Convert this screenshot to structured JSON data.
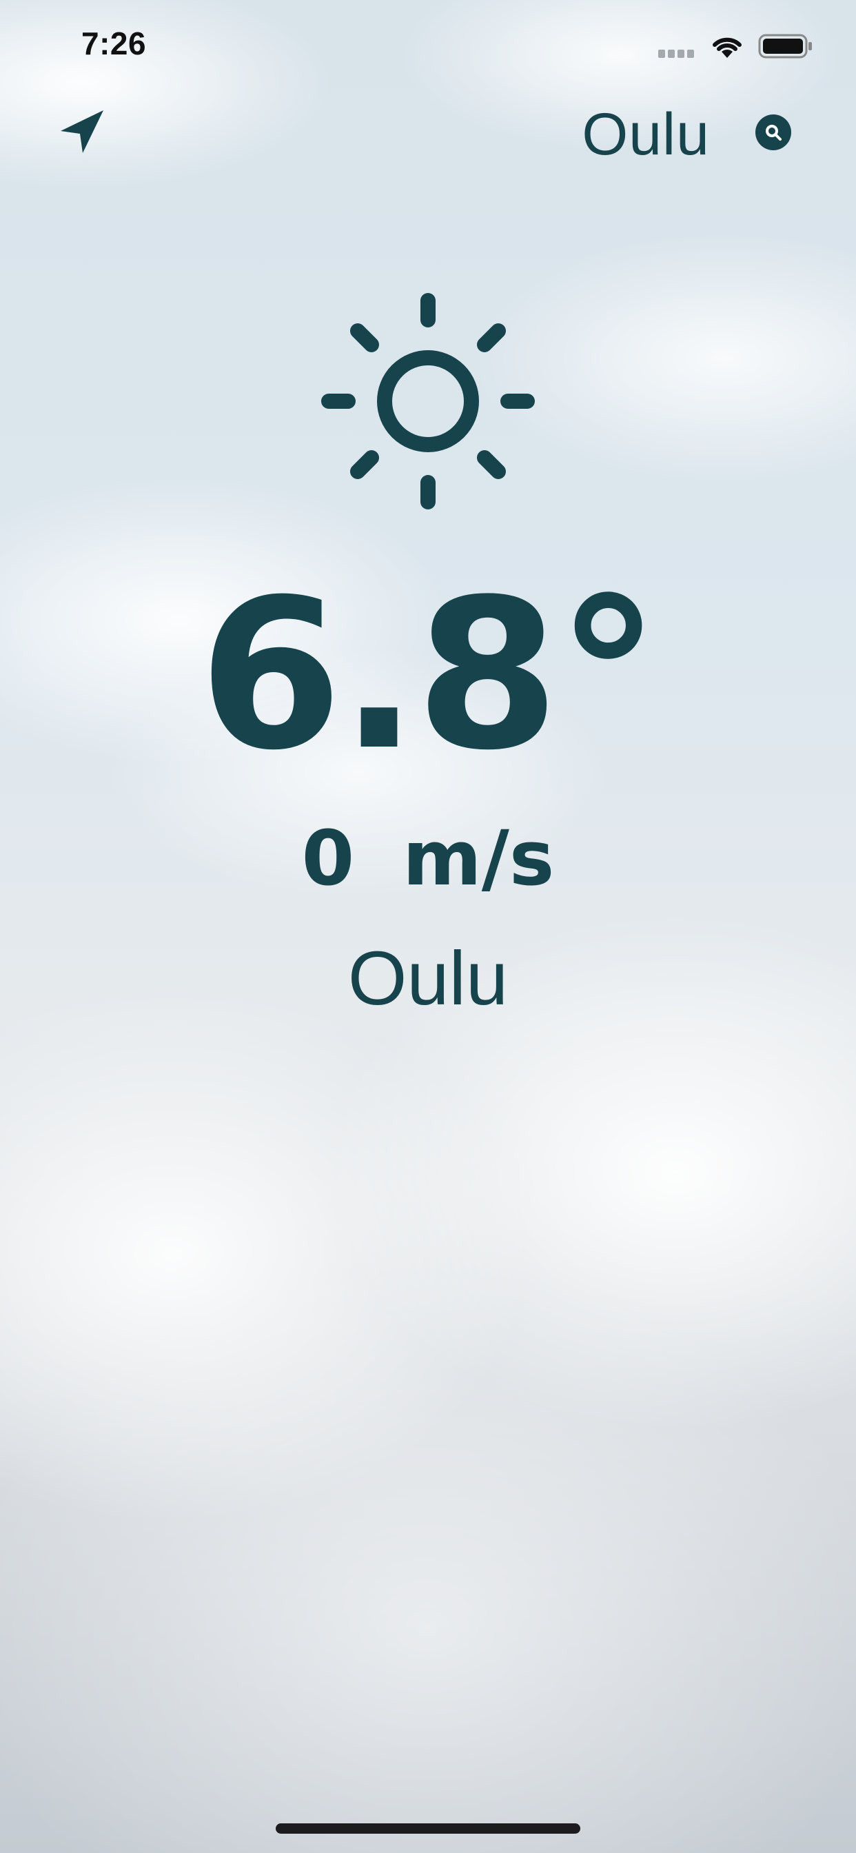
{
  "status_bar": {
    "time": "7:26",
    "signal_icon": "cellular-signal-icon",
    "wifi_icon": "wifi-icon",
    "battery_icon": "battery-icon"
  },
  "header": {
    "location_icon": "location-arrow-icon",
    "city": "Oulu",
    "search_icon": "search-icon"
  },
  "weather": {
    "condition_icon": "sun-icon",
    "temperature": "6.8°",
    "wind_value": "0",
    "wind_unit": "m/s",
    "city": "Oulu"
  },
  "colors": {
    "accent": "#17444c"
  }
}
